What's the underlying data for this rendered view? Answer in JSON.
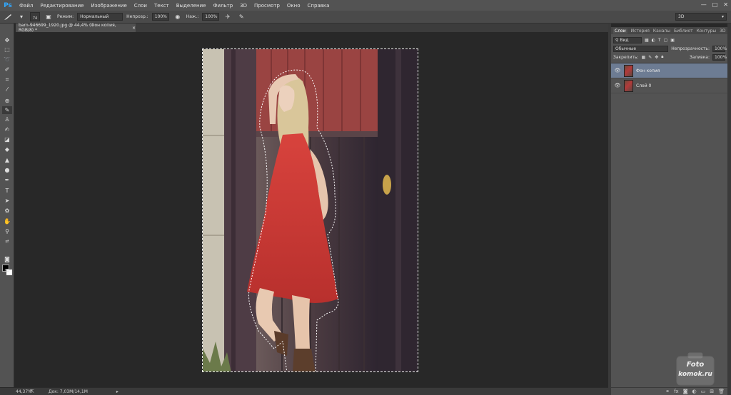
{
  "app": {
    "logo": "Ps"
  },
  "menu": [
    "Файл",
    "Редактирование",
    "Изображение",
    "Слои",
    "Текст",
    "Выделение",
    "Фильтр",
    "3D",
    "Просмотр",
    "Окно",
    "Справка"
  ],
  "window_controls": {
    "minimize": "—",
    "maximize": "□",
    "close": "✕"
  },
  "options": {
    "brush_size": "74",
    "mode_label": "Режим:",
    "mode_value": "Нормальный",
    "opacity_label": "Непрозр.:",
    "opacity_value": "100%",
    "flow_label": "Наж.:",
    "flow_value": "100%",
    "workspace": "3D"
  },
  "document": {
    "tab_title": "barn-946699_1920.jpg @ 44,4% (Фон копия, RGB/8) *",
    "close": "×"
  },
  "status": {
    "zoom": "44,37%",
    "doc_info": "Док: 7,03M/14,1M"
  },
  "panel": {
    "tabs": [
      "Слои",
      "История",
      "Каналы",
      "Библиот",
      "Контуры",
      "3D"
    ],
    "filter_label": "Вид",
    "blend_mode": "Обычные",
    "opacity_label": "Непрозрачность:",
    "opacity_value": "100%",
    "lock_label": "Закрепить:",
    "fill_label": "Заливка:",
    "fill_value": "100%",
    "layers": [
      {
        "name": "Фон копия",
        "selected": true
      },
      {
        "name": "Слой 0",
        "selected": false
      }
    ],
    "footer_icons": [
      "link-icon",
      "fx-icon",
      "mask-icon",
      "adjustment-icon",
      "group-icon",
      "new-layer-icon",
      "trash-icon"
    ]
  },
  "watermark": {
    "line1": "Foto",
    "line2": "komok.ru"
  },
  "colors": {
    "selected_layer": "#6d7c93",
    "ps_blue": "#31a8ff",
    "dress_red": "#c93a35"
  }
}
